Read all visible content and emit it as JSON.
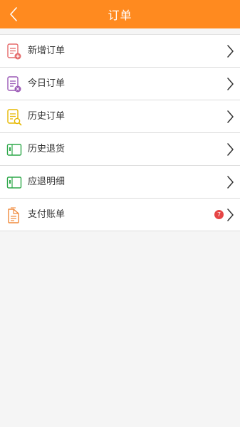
{
  "header": {
    "title": "订单",
    "background_color": "#ff8a1f",
    "back_icon": "chevron-left-icon"
  },
  "menu": {
    "items": [
      {
        "label": "新增订单",
        "icon": "order-add-icon",
        "icon_color": "#e56a6a"
      },
      {
        "label": "今日订单",
        "icon": "order-today-icon",
        "icon_color": "#9b59b6"
      },
      {
        "label": "历史订单",
        "icon": "order-history-search-icon",
        "icon_color": "#e6b800"
      },
      {
        "label": "历史退货",
        "icon": "return-history-icon",
        "icon_color": "#2ea84a"
      },
      {
        "label": "应退明细",
        "icon": "refund-detail-icon",
        "icon_color": "#2ea84a"
      },
      {
        "label": "支付账单",
        "icon": "bill-icon",
        "icon_color": "#f08a3c",
        "badge": "7",
        "badge_color": "#e64545"
      }
    ]
  }
}
